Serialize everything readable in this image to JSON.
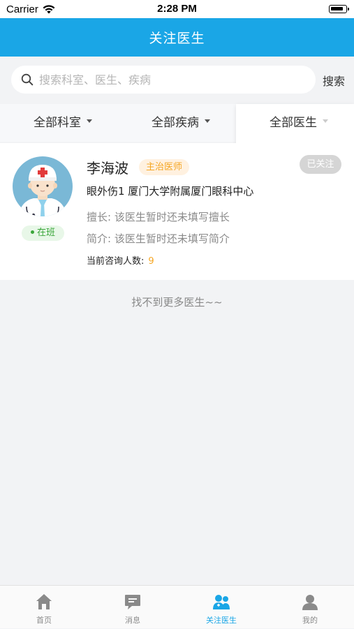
{
  "status_bar": {
    "carrier": "Carrier",
    "time": "2:28 PM"
  },
  "nav": {
    "title": "关注医生"
  },
  "search": {
    "placeholder": "搜索科室、医生、疾病",
    "button_label": "搜索"
  },
  "filters": [
    {
      "label": "全部科室"
    },
    {
      "label": "全部疾病"
    },
    {
      "label": "全部医生"
    }
  ],
  "doctors": [
    {
      "name": "李海波",
      "title": "主治医师",
      "follow_label": "已关注",
      "status": "在班",
      "dept_hospital": "眼外伤1  厦门大学附属厦门眼科中心",
      "specialty": "擅长: 该医生暂时还未填写擅长",
      "intro": "简介: 该医生暂时还未填写简介",
      "consult_label": "当前咨询人数:",
      "consult_count": "9"
    }
  ],
  "list_footer": "找不到更多医生~~",
  "tabs": [
    {
      "label": "首页",
      "icon": "home-icon",
      "active": false
    },
    {
      "label": "消息",
      "icon": "message-icon",
      "active": false
    },
    {
      "label": "关注医生",
      "icon": "followed-doctors-icon",
      "active": true
    },
    {
      "label": "我的",
      "icon": "profile-icon",
      "active": false
    }
  ],
  "colors": {
    "primary": "#1aa6e6",
    "title_badge": "#f5a623",
    "on_duty": "#3aa63a",
    "followed_button": "#d5d5d5",
    "background": "#f2f3f5"
  }
}
